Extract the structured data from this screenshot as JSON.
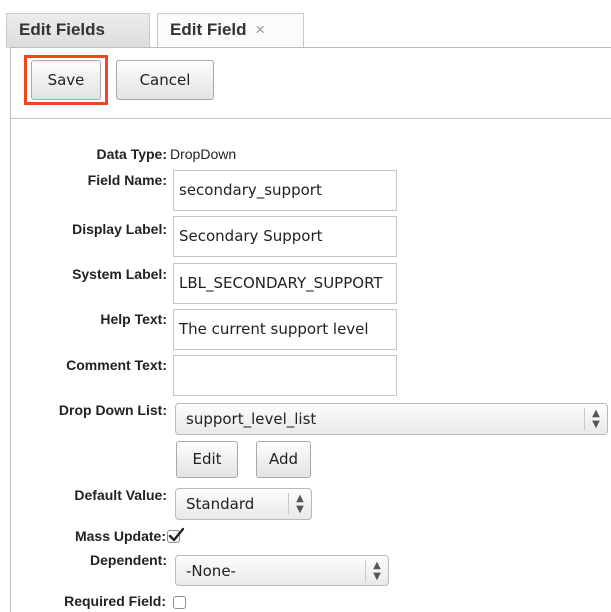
{
  "tabs": [
    {
      "label": "Edit Fields"
    },
    {
      "label": "Edit Field",
      "close": "×"
    }
  ],
  "toolbar": {
    "save_label": "Save",
    "cancel_label": "Cancel"
  },
  "form": {
    "data_type": {
      "label": "Data Type:",
      "value": "DropDown"
    },
    "field_name": {
      "label": "Field Name:",
      "value": "secondary_support"
    },
    "display_label": {
      "label": "Display Label:",
      "value": "Secondary Support"
    },
    "system_label": {
      "label": "System Label:",
      "value": "LBL_SECONDARY_SUPPORT"
    },
    "help_text": {
      "label": "Help Text:",
      "value": "The current support level"
    },
    "comment_text": {
      "label": "Comment Text:",
      "value": ""
    },
    "dropdown_list": {
      "label": "Drop Down List:",
      "value": "support_level_list",
      "edit_label": "Edit",
      "add_label": "Add"
    },
    "default_value": {
      "label": "Default Value:",
      "value": "Standard"
    },
    "mass_update": {
      "label": "Mass Update:",
      "checked": true
    },
    "dependent": {
      "label": "Dependent:",
      "value": "-None-"
    },
    "required_field": {
      "label": "Required Field:",
      "checked": false
    }
  },
  "icons": {
    "select_arrows": "updown-arrows-icon",
    "check": "checkmark-icon"
  },
  "colors": {
    "highlight": "#f2461f"
  }
}
